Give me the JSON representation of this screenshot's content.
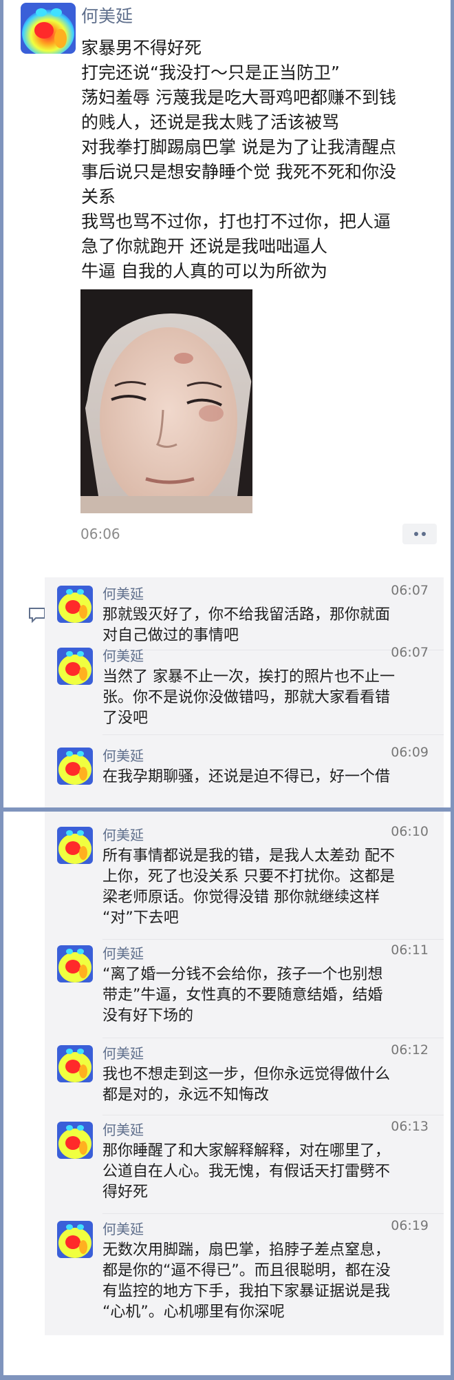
{
  "post": {
    "author": "何美延",
    "lines": [
      "家暴男不得好死",
      "打完还说“我没打～只是正当防卫”",
      "荡妇羞辱 污蔑我是吃大哥鸡吧都赚不到钱",
      "的贱人，还说是我太贱了活该被骂",
      "对我拳打脚踢扇巴掌 说是为了让我清醒点",
      "事后说只是想安静睡个觉 我死不死和你没",
      "关系",
      "我骂也骂不过你，打也打不过你，把人逼",
      "急了你就跑开 还说是我咄咄逼人",
      "牛逼 自我的人真的可以为所欲为"
    ],
    "time": "06:06",
    "more_icon": "more-dots-icon"
  },
  "comments_top": [
    {
      "name": "何美延",
      "time": "06:07",
      "lines": [
        "那就毁灭好了，你不给我留活路，那你就面",
        "对自己做过的事情吧"
      ]
    },
    {
      "name": "何美延",
      "time": "06:07",
      "lines": [
        "当然了 家暴不止一次，挨打的照片也不止一",
        "张。你不是说你没做错吗，那就大家看看错",
        "了没吧"
      ]
    },
    {
      "name": "何美延",
      "time": "06:09",
      "lines": [
        "在我孕期聊骚，还说是迫不得已，好一个借"
      ]
    }
  ],
  "comments_bottom": [
    {
      "name": "何美延",
      "time": "06:10",
      "lines": [
        "所有事情都说是我的错，是我人太差劲 配不",
        "上你，死了也没关系 只要不打扰你。这都是",
        "梁老师原话。你觉得没错 那你就继续这样",
        "“对”下去吧"
      ]
    },
    {
      "name": "何美延",
      "time": "06:11",
      "lines": [
        "“离了婚一分钱不会给你，孩子一个也别想",
        "带走”牛逼，女性真的不要随意结婚，结婚",
        "没有好下场的"
      ]
    },
    {
      "name": "何美延",
      "time": "06:12",
      "lines": [
        "我也不想走到这一步，但你永远觉得做什么",
        "都是对的，永远不知悔改"
      ]
    },
    {
      "name": "何美延",
      "time": "06:13",
      "lines": [
        "那你睡醒了和大家解释解释，对在哪里了，",
        "公道自在人心。我无愧，有假话天打雷劈不",
        "得好死"
      ]
    },
    {
      "name": "何美延",
      "time": "06:19",
      "lines": [
        "无数次用脚踹，扇巴掌，掐脖子差点窒息，",
        "都是你的“逼不得已”。而且很聪明，都在没",
        "有监控的地方下手，我拍下家暴证据说是我",
        "“心机”。心机哪里有你深呢"
      ]
    }
  ],
  "colors": {
    "background": "#7f94bd",
    "name": "#5f6f8c",
    "comments_bg": "#f3f3f5"
  }
}
